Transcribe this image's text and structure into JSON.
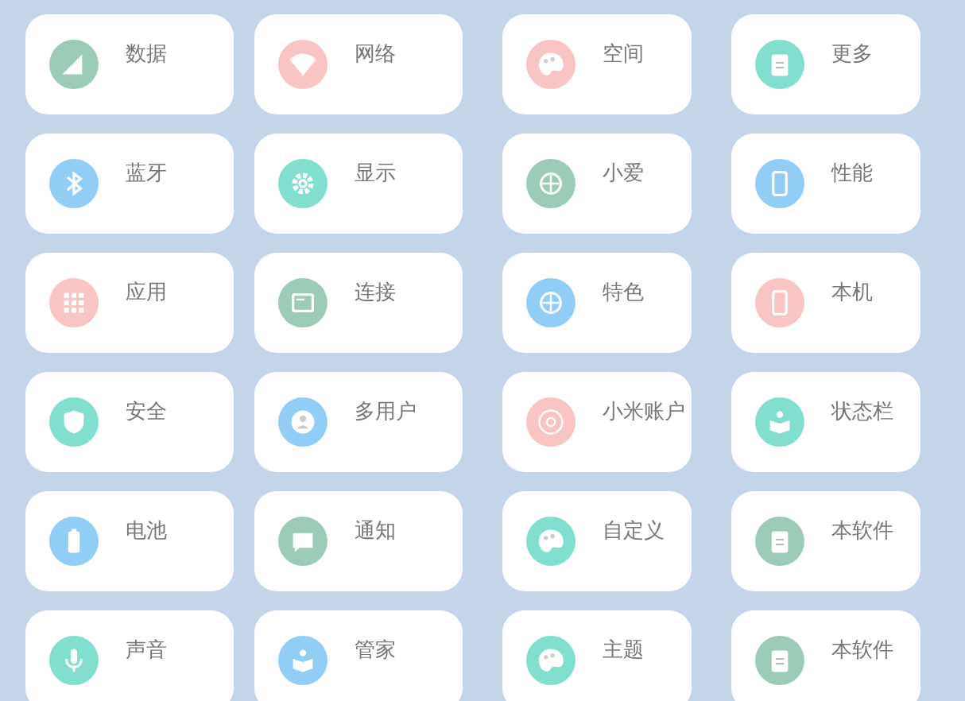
{
  "tiles": [
    {
      "label": "数据",
      "kind": "signal",
      "color": "#9ccbb8"
    },
    {
      "label": "网络",
      "kind": "wifi",
      "color": "#f8c4c4"
    },
    {
      "label": "空间",
      "kind": "palette",
      "color": "#f8c4c4"
    },
    {
      "label": "更多",
      "kind": "clipboard",
      "color": "#82dfcf"
    },
    {
      "label": "蓝牙",
      "kind": "bluetooth",
      "color": "#92cdf5"
    },
    {
      "label": "显示",
      "kind": "gear",
      "color": "#82dfcf"
    },
    {
      "label": "小爱",
      "kind": "target",
      "color": "#9ccbb8"
    },
    {
      "label": "性能",
      "kind": "phone",
      "color": "#92cdf5"
    },
    {
      "label": "应用",
      "kind": "grid",
      "color": "#f8c4c4"
    },
    {
      "label": "连接",
      "kind": "picture",
      "color": "#9ccbb8"
    },
    {
      "label": "特色",
      "kind": "target",
      "color": "#92cdf5"
    },
    {
      "label": "本机",
      "kind": "phone",
      "color": "#f8c4c4"
    },
    {
      "label": "安全",
      "kind": "shield",
      "color": "#82dfcf"
    },
    {
      "label": "多用户",
      "kind": "person",
      "color": "#92cdf5"
    },
    {
      "label": "小米账户",
      "kind": "ring",
      "color": "#f8c4c4"
    },
    {
      "label": "状态栏",
      "kind": "book",
      "color": "#82dfcf"
    },
    {
      "label": "电池",
      "kind": "battery",
      "color": "#92cdf5"
    },
    {
      "label": "通知",
      "kind": "chat",
      "color": "#9ccbb8"
    },
    {
      "label": "自定义",
      "kind": "palette",
      "color": "#82dfcf"
    },
    {
      "label": "本软件",
      "kind": "clipboard",
      "color": "#9ccbb8"
    },
    {
      "label": "声音",
      "kind": "mic",
      "color": "#82dfcf"
    },
    {
      "label": "管家",
      "kind": "book",
      "color": "#92cdf5"
    },
    {
      "label": "主题",
      "kind": "palette",
      "color": "#82dfcf"
    },
    {
      "label": "本软件",
      "kind": "clipboard",
      "color": "#9ccbb8"
    }
  ]
}
